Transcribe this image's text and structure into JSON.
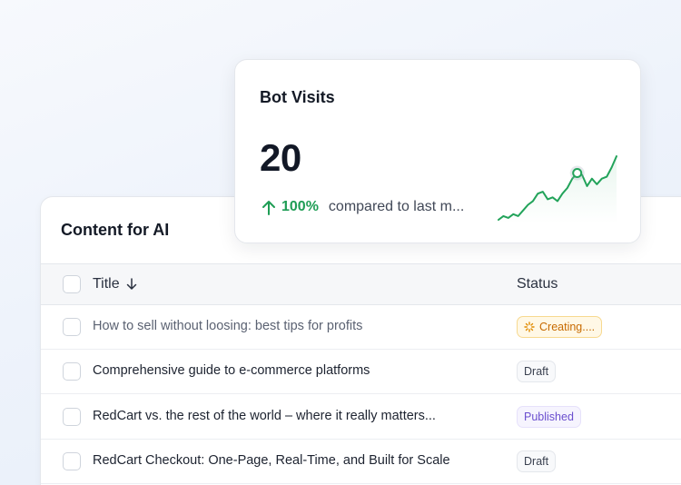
{
  "content_table": {
    "title": "Content for AI",
    "columns": {
      "title": "Title",
      "status": "Status"
    },
    "rows": [
      {
        "title": "How to sell without loosing: best tips for profits",
        "status": "Creating....",
        "status_type": "creating"
      },
      {
        "title": "Comprehensive guide to e-commerce platforms",
        "status": "Draft",
        "status_type": "draft"
      },
      {
        "title": "RedCart vs. the rest of the world – where it really matters...",
        "status": "Published",
        "status_type": "published"
      },
      {
        "title": "RedCart Checkout: One-Page, Real-Time, and Built for Scale",
        "status": "Draft",
        "status_type": "draft"
      }
    ]
  },
  "bot_visits": {
    "title": "Bot Visits",
    "value": "20",
    "change_pct": "100%",
    "change_text": "compared to last m...",
    "change_direction": "up",
    "sparkline": [
      2,
      6,
      4,
      8,
      6,
      12,
      18,
      22,
      30,
      32,
      24,
      26,
      22,
      30,
      36,
      46,
      52,
      50,
      38,
      46,
      40,
      46,
      48,
      58,
      70
    ],
    "highlight_index": 16
  },
  "colors": {
    "positive": "#1f9d55",
    "creating": "#c76a00",
    "published": "#6b4fcf",
    "sparkline": "#22a35a"
  },
  "icons": {
    "sort": "arrow-down-icon",
    "trend": "arrow-up-icon",
    "creating": "spinner-icon"
  }
}
